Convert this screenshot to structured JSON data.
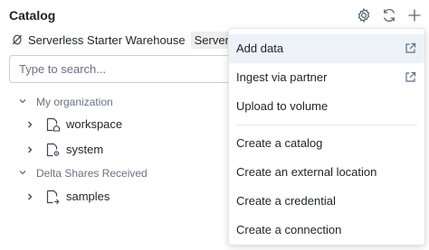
{
  "header": {
    "title": "Catalog",
    "icons": [
      "gear-icon",
      "refresh-icon",
      "plus-icon"
    ]
  },
  "warehouse": {
    "icon": "warehouse-off-icon",
    "name": "Serverless Starter Warehouse",
    "chip": "Serverless"
  },
  "search": {
    "placeholder": "Type to search...",
    "value": ""
  },
  "tree": {
    "sections": [
      {
        "label": "My organization",
        "expanded": true,
        "items": [
          {
            "label": "workspace",
            "icon": "catalog-home-icon"
          },
          {
            "label": "system",
            "icon": "catalog-gear-icon"
          }
        ]
      },
      {
        "label": "Delta Shares Received",
        "expanded": true,
        "items": [
          {
            "label": "samples",
            "icon": "catalog-share-icon"
          }
        ]
      }
    ]
  },
  "menu": {
    "items": [
      {
        "label": "Add data",
        "external": true,
        "highlighted": true
      },
      {
        "label": "Ingest via partner",
        "external": true
      },
      {
        "label": "Upload to volume",
        "external": false
      },
      {
        "label": "Create a catalog",
        "external": false
      },
      {
        "label": "Create an external location",
        "external": false
      },
      {
        "label": "Create a credential",
        "external": false
      },
      {
        "label": "Create a connection",
        "external": false
      }
    ]
  },
  "colors": {
    "menu_highlight": "#ecf2f8",
    "border": "#c9ced6",
    "muted_text": "#6b7280"
  }
}
